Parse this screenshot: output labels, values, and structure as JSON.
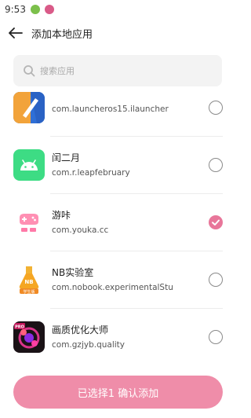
{
  "status_bar": {
    "time": "9:53"
  },
  "header": {
    "title": "添加本地应用",
    "back_icon": "arrow-left-icon"
  },
  "search": {
    "placeholder": "搜索应用",
    "icon": "search-icon"
  },
  "apps": [
    {
      "name": "",
      "package": "com.launcheros15.ilauncher",
      "icon": "launcher-icon",
      "selected": false
    },
    {
      "name": "闰二月",
      "package": "com.r.leapfebruary",
      "icon": "android-icon",
      "selected": false
    },
    {
      "name": "游咔",
      "package": "com.youka.cc",
      "icon": "gamepad-icon",
      "selected": true
    },
    {
      "name": "NB实验室",
      "package": "com.nobook.experimentalStu",
      "icon": "flask-icon",
      "icon_label": "学生版",
      "selected": false
    },
    {
      "name": "画质优化大师",
      "package": "com.gzjyb.quality",
      "icon": "pro-badge-icon",
      "icon_label": "PRO",
      "selected": false
    }
  ],
  "confirm_button": {
    "label": "已选择1 确认添加"
  },
  "colors": {
    "accent": "#e8769a",
    "button": "#ef8da9",
    "android_green": "#3ddc84"
  }
}
